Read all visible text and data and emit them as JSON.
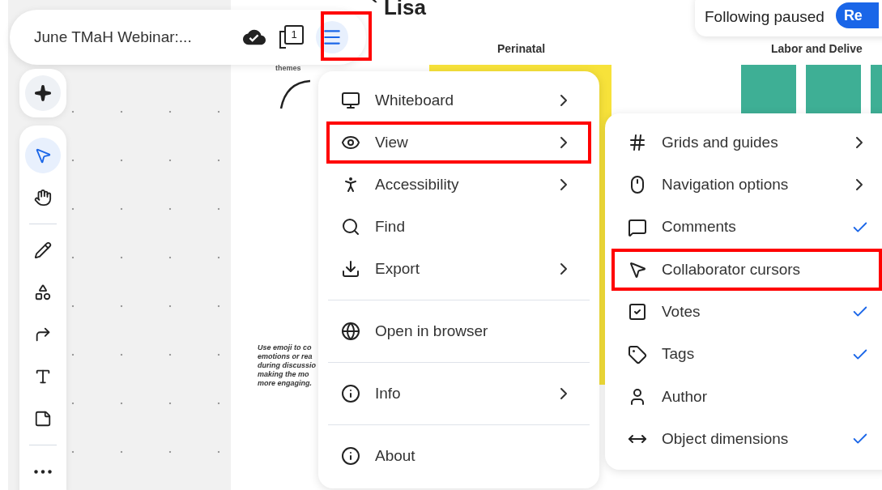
{
  "toolbar": {
    "title": "June TMaH Webinar:...",
    "page_count": "1",
    "menu_button": {
      "highlighted": true
    }
  },
  "canvas": {
    "heading": "` Lisa",
    "labels": [
      "Perinatal",
      "Labor and Delive"
    ],
    "caption": "themes",
    "note": "Use emoji to co emotions or rea during discussio making the mo more engaging."
  },
  "follow_banner": {
    "text": "Following paused",
    "button": "Re"
  },
  "tools": [
    {
      "kind": "ai",
      "selected": false
    },
    {
      "kind": "select",
      "selected": true
    },
    {
      "kind": "hand",
      "selected": false
    },
    {
      "kind": "pen",
      "selected": false
    },
    {
      "kind": "shapes",
      "selected": false
    },
    {
      "kind": "connector",
      "selected": false
    },
    {
      "kind": "text",
      "selected": false
    },
    {
      "kind": "sticky",
      "selected": false
    },
    {
      "kind": "more",
      "selected": false
    }
  ],
  "main_menu": [
    {
      "label": "Whiteboard",
      "kind": "submenu",
      "highlighted": false,
      "divider_before": false
    },
    {
      "label": "View",
      "kind": "submenu",
      "highlighted": true,
      "divider_before": false
    },
    {
      "label": "Accessibility",
      "kind": "submenu",
      "highlighted": false,
      "divider_before": false
    },
    {
      "label": "Find",
      "kind": "action",
      "highlighted": false,
      "divider_before": false
    },
    {
      "label": "Export",
      "kind": "submenu",
      "highlighted": false,
      "divider_before": false
    },
    {
      "label": "Open in browser",
      "kind": "action",
      "highlighted": false,
      "divider_before": true
    },
    {
      "label": "Info",
      "kind": "submenu",
      "highlighted": false,
      "divider_before": true
    },
    {
      "label": "About",
      "kind": "action",
      "highlighted": false,
      "divider_before": true
    }
  ],
  "view_menu": [
    {
      "label": "Grids and guides",
      "kind": "submenu",
      "highlighted": false
    },
    {
      "label": "Navigation options",
      "kind": "submenu",
      "highlighted": false
    },
    {
      "label": "Comments",
      "kind": "toggle",
      "checked": true,
      "highlighted": false
    },
    {
      "label": "Collaborator cursors",
      "kind": "toggle",
      "checked": false,
      "highlighted": true
    },
    {
      "label": "Votes",
      "kind": "toggle",
      "checked": true,
      "highlighted": false
    },
    {
      "label": "Tags",
      "kind": "toggle",
      "checked": true,
      "highlighted": false
    },
    {
      "label": "Author",
      "kind": "toggle",
      "checked": false,
      "highlighted": false
    },
    {
      "label": "Object dimensions",
      "kind": "toggle",
      "checked": true,
      "highlighted": false
    }
  ]
}
